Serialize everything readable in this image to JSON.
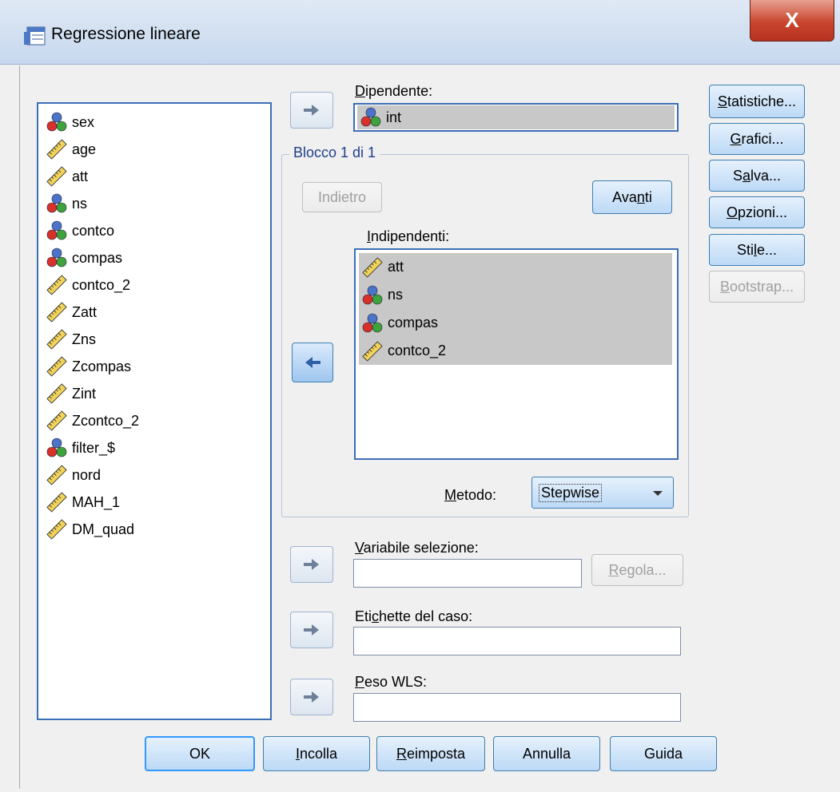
{
  "window": {
    "title": "Regressione lineare",
    "close_label": "X"
  },
  "variables": [
    {
      "name": "sex",
      "type": "nominal"
    },
    {
      "name": "age",
      "type": "scale"
    },
    {
      "name": "att",
      "type": "scale"
    },
    {
      "name": "ns",
      "type": "nominal"
    },
    {
      "name": "contco",
      "type": "nominal"
    },
    {
      "name": "compas",
      "type": "nominal"
    },
    {
      "name": "contco_2",
      "type": "scale"
    },
    {
      "name": "Zatt",
      "type": "scale"
    },
    {
      "name": "Zns",
      "type": "scale"
    },
    {
      "name": "Zcompas",
      "type": "scale"
    },
    {
      "name": "Zint",
      "type": "scale"
    },
    {
      "name": "Zcontco_2",
      "type": "scale"
    },
    {
      "name": "filter_$",
      "type": "nominal"
    },
    {
      "name": "nord",
      "type": "scale"
    },
    {
      "name": "MAH_1",
      "type": "scale"
    },
    {
      "name": "DM_quad",
      "type": "scale"
    }
  ],
  "dependent": {
    "label": "Dipendente:",
    "value": "int"
  },
  "block": {
    "title": "Blocco 1 di 1",
    "prev_label": "Indietro",
    "next_label": "Avanti"
  },
  "independents": {
    "label": "Indipendenti:",
    "items": [
      {
        "name": "att",
        "type": "scale"
      },
      {
        "name": "ns",
        "type": "nominal"
      },
      {
        "name": "compas",
        "type": "nominal"
      },
      {
        "name": "contco_2",
        "type": "scale"
      }
    ]
  },
  "method": {
    "label": "Metodo:",
    "value": "Stepwise"
  },
  "selection_variable": {
    "label": "Variabile selezione:",
    "value": "",
    "rule_label": "Regola..."
  },
  "case_labels": {
    "label": "Etichette del caso:",
    "value": ""
  },
  "wls_weight": {
    "label": "Peso WLS:",
    "value": ""
  },
  "side_buttons": {
    "statistics": "Statistiche...",
    "plots": "Grafici...",
    "save": "Salva...",
    "options": "Opzioni...",
    "style": "Stile...",
    "bootstrap": "Bootstrap..."
  },
  "bottom_buttons": {
    "ok": "OK",
    "paste": "Incolla",
    "reset": "Reimposta",
    "cancel": "Annulla",
    "help": "Guida"
  },
  "colors": {
    "accent": "#3b6fb6",
    "selection": "#c8c8c8",
    "close": "#c8452e"
  }
}
